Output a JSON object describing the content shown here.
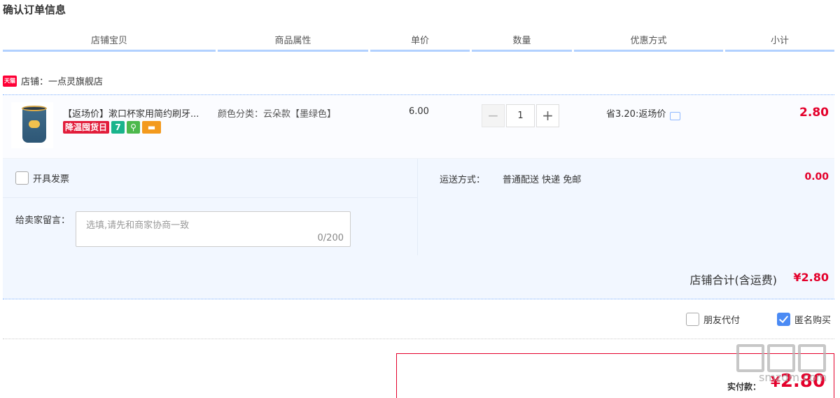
{
  "page_title": "确认订单信息",
  "columns": [
    "店铺宝贝",
    "商品属性",
    "单价",
    "数量",
    "优惠方式",
    "小计"
  ],
  "shop": {
    "icon_text": "天猫",
    "label": "店铺：一点灵旗舰店"
  },
  "item": {
    "title": "【返场价】漱口杯家用简约刷牙...",
    "badges": {
      "promo": "降温囤货日",
      "seven": "7"
    },
    "attribute": "颜色分类：云朵款【墨绿色】",
    "unit_price": "6.00",
    "qty_minus": "−",
    "quantity": "1",
    "qty_plus": "+",
    "discount": "省3.20:返场价",
    "subtotal": "2.80"
  },
  "invoice_label": "开具发票",
  "message": {
    "label": "给卖家留言：",
    "placeholder": "选填,请先和商家协商一致",
    "count": "0/200"
  },
  "shipping": {
    "label": "运送方式：",
    "value": "普通配送 快递 免邮",
    "fee": "0.00"
  },
  "shop_total": {
    "label": "店铺合计(含运费)",
    "value": "¥2.80"
  },
  "options": {
    "friend_pay": "朋友代付",
    "anonymous": "匿名购买",
    "anonymous_checked": true
  },
  "pay": {
    "label": "实付款：",
    "yen": "¥",
    "amount": "2.80"
  },
  "watermark_text": "smzdm.com",
  "colors": {
    "accent_red": "#e4002b",
    "header_border": "#b2d1ff",
    "panel_bg": "#f2f7ff"
  }
}
